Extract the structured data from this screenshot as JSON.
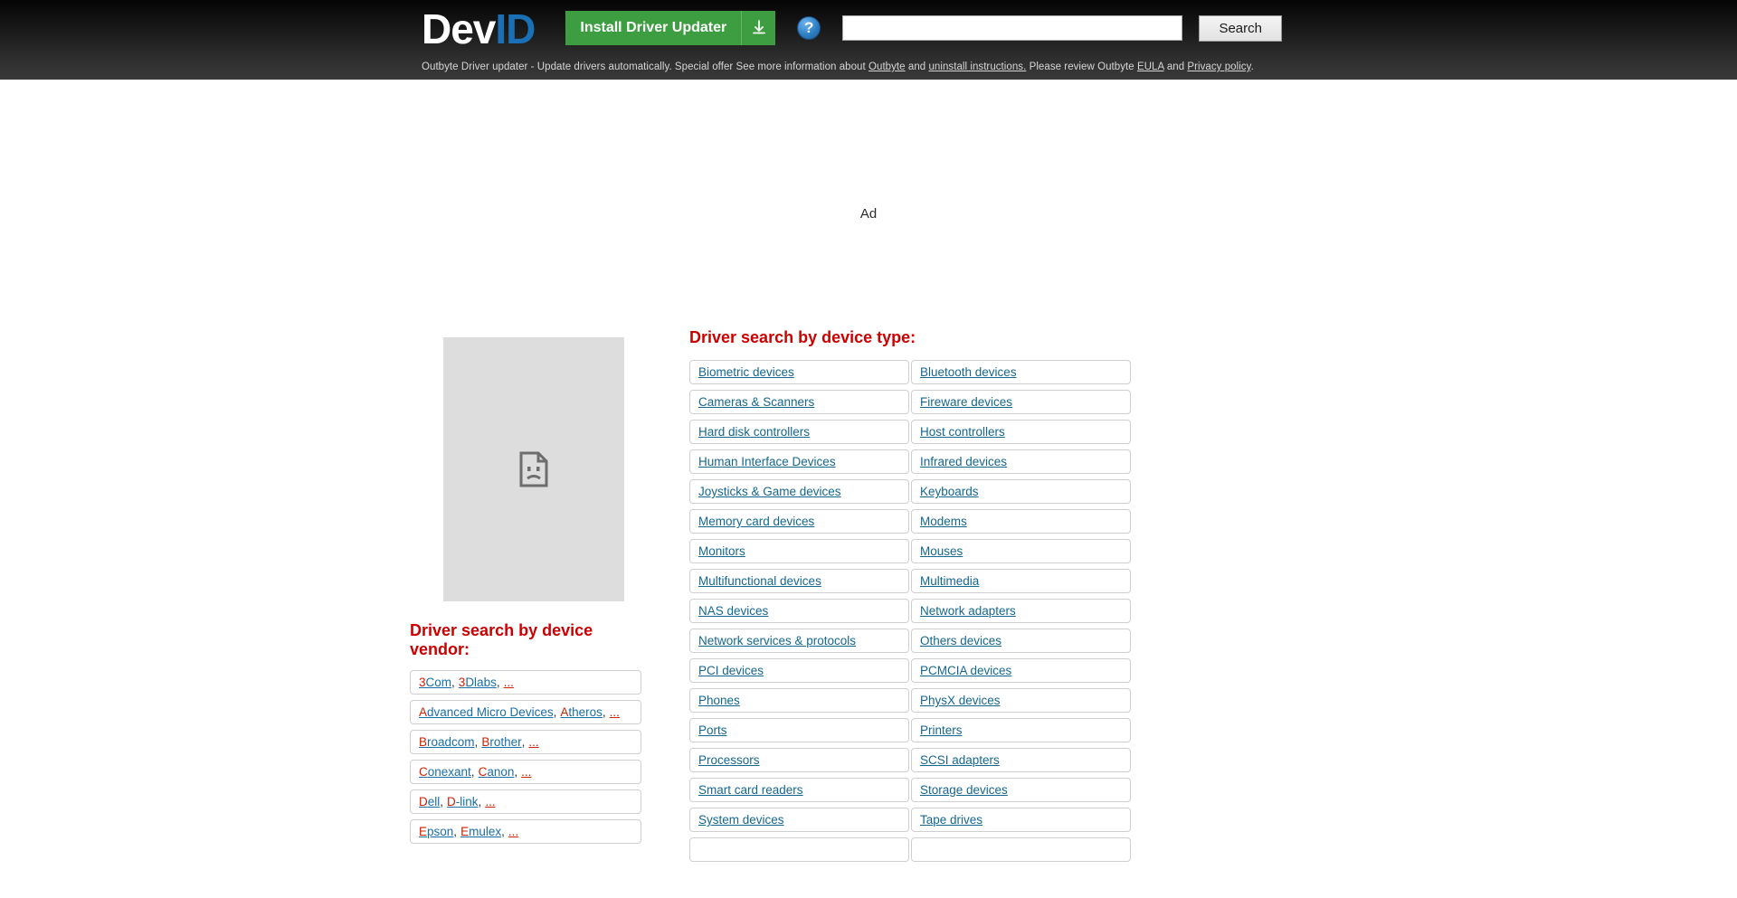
{
  "header": {
    "logo_dev": "Dev",
    "logo_id": "ID",
    "install_button": "Install Driver Updater",
    "download_icon": "download-icon",
    "help_icon": "?",
    "search_value": "",
    "search_placeholder": "",
    "search_button": "Search",
    "disclaimer": {
      "part1": "Outbyte Driver updater - Update drivers automatically. Special offer See more information about ",
      "link1": "Outbyte",
      "part2": " and ",
      "link2": "uninstall instructions.",
      "part3": " Please review Outbyte ",
      "link3": "EULA",
      "part4": " and ",
      "link4": "Privacy policy",
      "part5": "."
    }
  },
  "ad": {
    "label": "Ad"
  },
  "vendors": {
    "title": "Driver search by device vendor:",
    "broken_image_icon": "broken-image-icon",
    "more_label": "...",
    "rows": [
      [
        {
          "initial": "3",
          "rest": "Com"
        },
        {
          "initial": "3",
          "rest": "Dlabs"
        }
      ],
      [
        {
          "initial": "A",
          "rest": "dvanced Micro Devices"
        },
        {
          "initial": "A",
          "rest": "theros"
        }
      ],
      [
        {
          "initial": "B",
          "rest": "roadcom"
        },
        {
          "initial": "B",
          "rest": "rother"
        }
      ],
      [
        {
          "initial": "C",
          "rest": "onexant"
        },
        {
          "initial": "C",
          "rest": "anon"
        }
      ],
      [
        {
          "initial": "D",
          "rest": "ell"
        },
        {
          "initial": "D",
          "rest": "-link"
        }
      ],
      [
        {
          "initial": "E",
          "rest": "pson"
        },
        {
          "initial": "E",
          "rest": "mulex"
        }
      ]
    ]
  },
  "device_types": {
    "title": "Driver search by device type:",
    "items": [
      "Biometric devices",
      "Bluetooth devices",
      "Cameras & Scanners",
      "Fireware devices",
      "Hard disk controllers",
      "Host controllers",
      "Human Interface Devices",
      "Infrared devices",
      "Joysticks & Game devices",
      "Keyboards",
      "Memory card devices",
      "Modems",
      "Monitors",
      "Mouses",
      "Multifunctional devices",
      "Multimedia",
      "NAS devices",
      "Network adapters",
      "Network services & protocols",
      "Others devices",
      "PCI devices",
      "PCMCIA devices",
      "Phones",
      "PhysX devices",
      "Ports",
      "Printers",
      "Processors",
      "SCSI adapters",
      "Smart card readers",
      "Storage devices",
      "System devices",
      "Tape drives",
      "",
      ""
    ]
  },
  "colors": {
    "brand_blue": "#1a6fb5",
    "install_green": "#3d9e41",
    "section_red": "#cc0000",
    "link_blue": "#15678f",
    "vendor_initial_red": "#cc2200",
    "header_dark": "#1b1b1b"
  }
}
